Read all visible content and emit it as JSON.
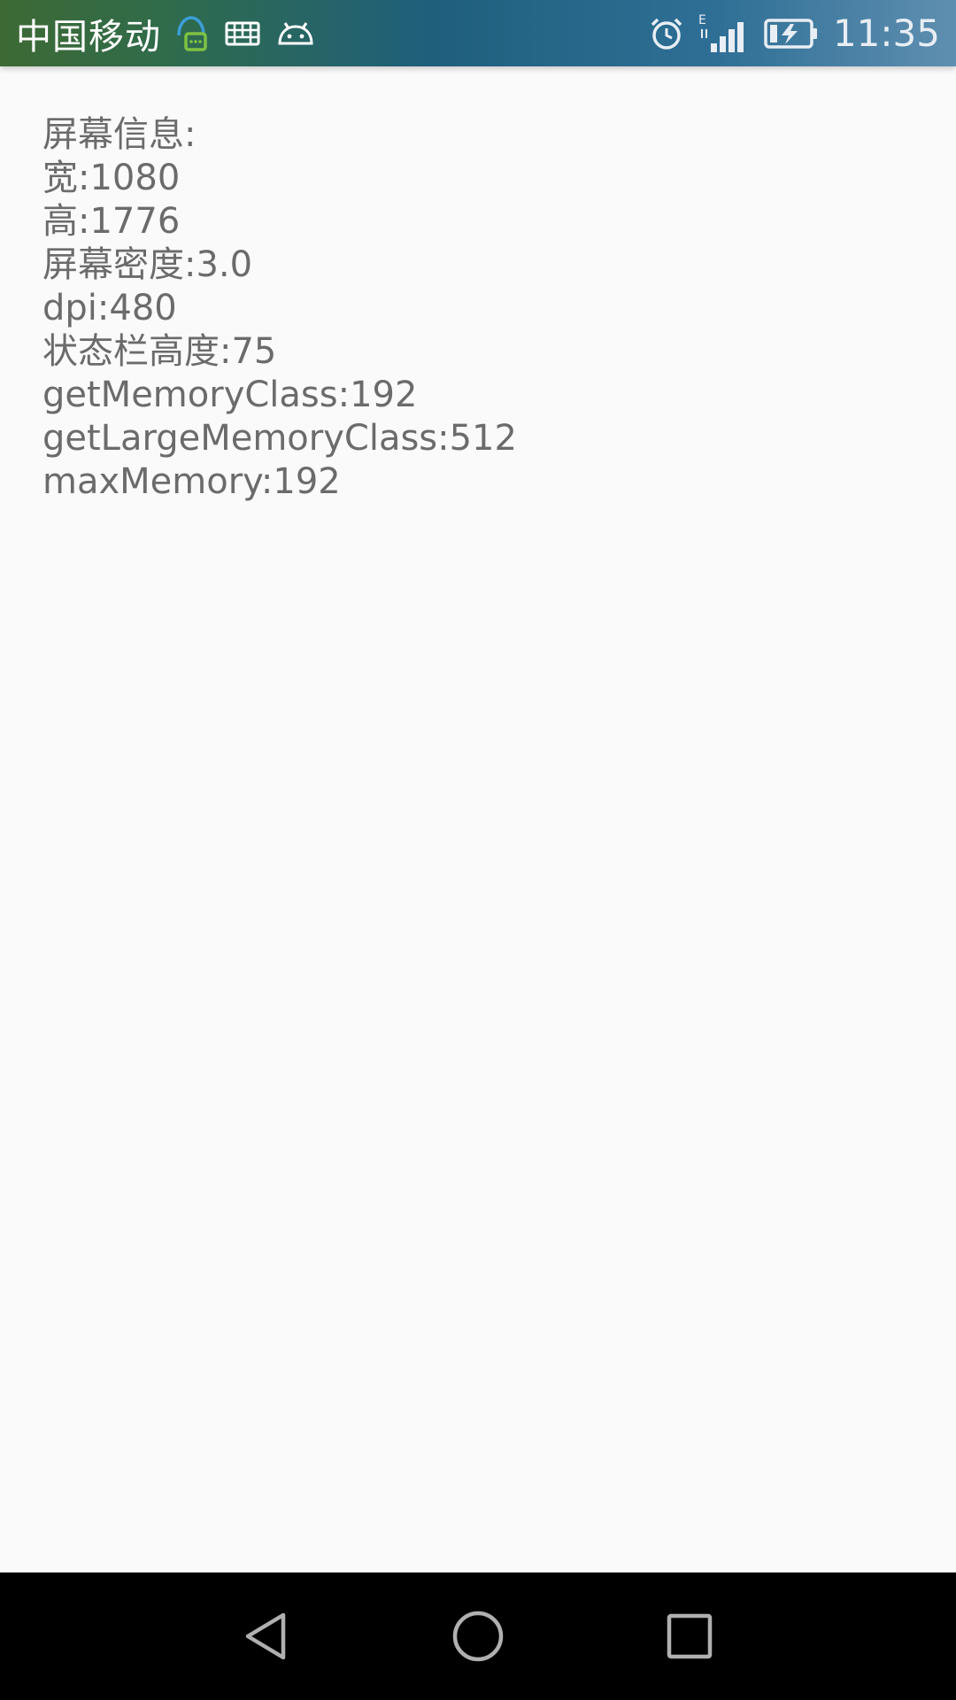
{
  "status_bar": {
    "carrier": "中国移动",
    "time": "11:35",
    "network_type": "E",
    "icons": [
      "chat-notification-icon",
      "keyboard-icon",
      "android-icon",
      "alarm-icon",
      "signal-icon",
      "battery-charging-icon"
    ],
    "colors": {
      "gradient_start": "#3d6a34",
      "gradient_end": "#5f8fb0",
      "notification_icon": "#7ec242"
    }
  },
  "screen_info": {
    "header": "屏幕信息:",
    "width": "宽:1080",
    "height": "高:1776",
    "density": "屏幕密度:3.0",
    "dpi": "dpi:480",
    "status_bar_height": "状态栏高度:75",
    "memory_class": "getMemoryClass:192",
    "large_memory_class": "getLargeMemoryClass:512",
    "max_memory": "maxMemory:192"
  },
  "nav_bar": {
    "icons": [
      "back-icon",
      "home-icon",
      "recents-icon"
    ]
  }
}
